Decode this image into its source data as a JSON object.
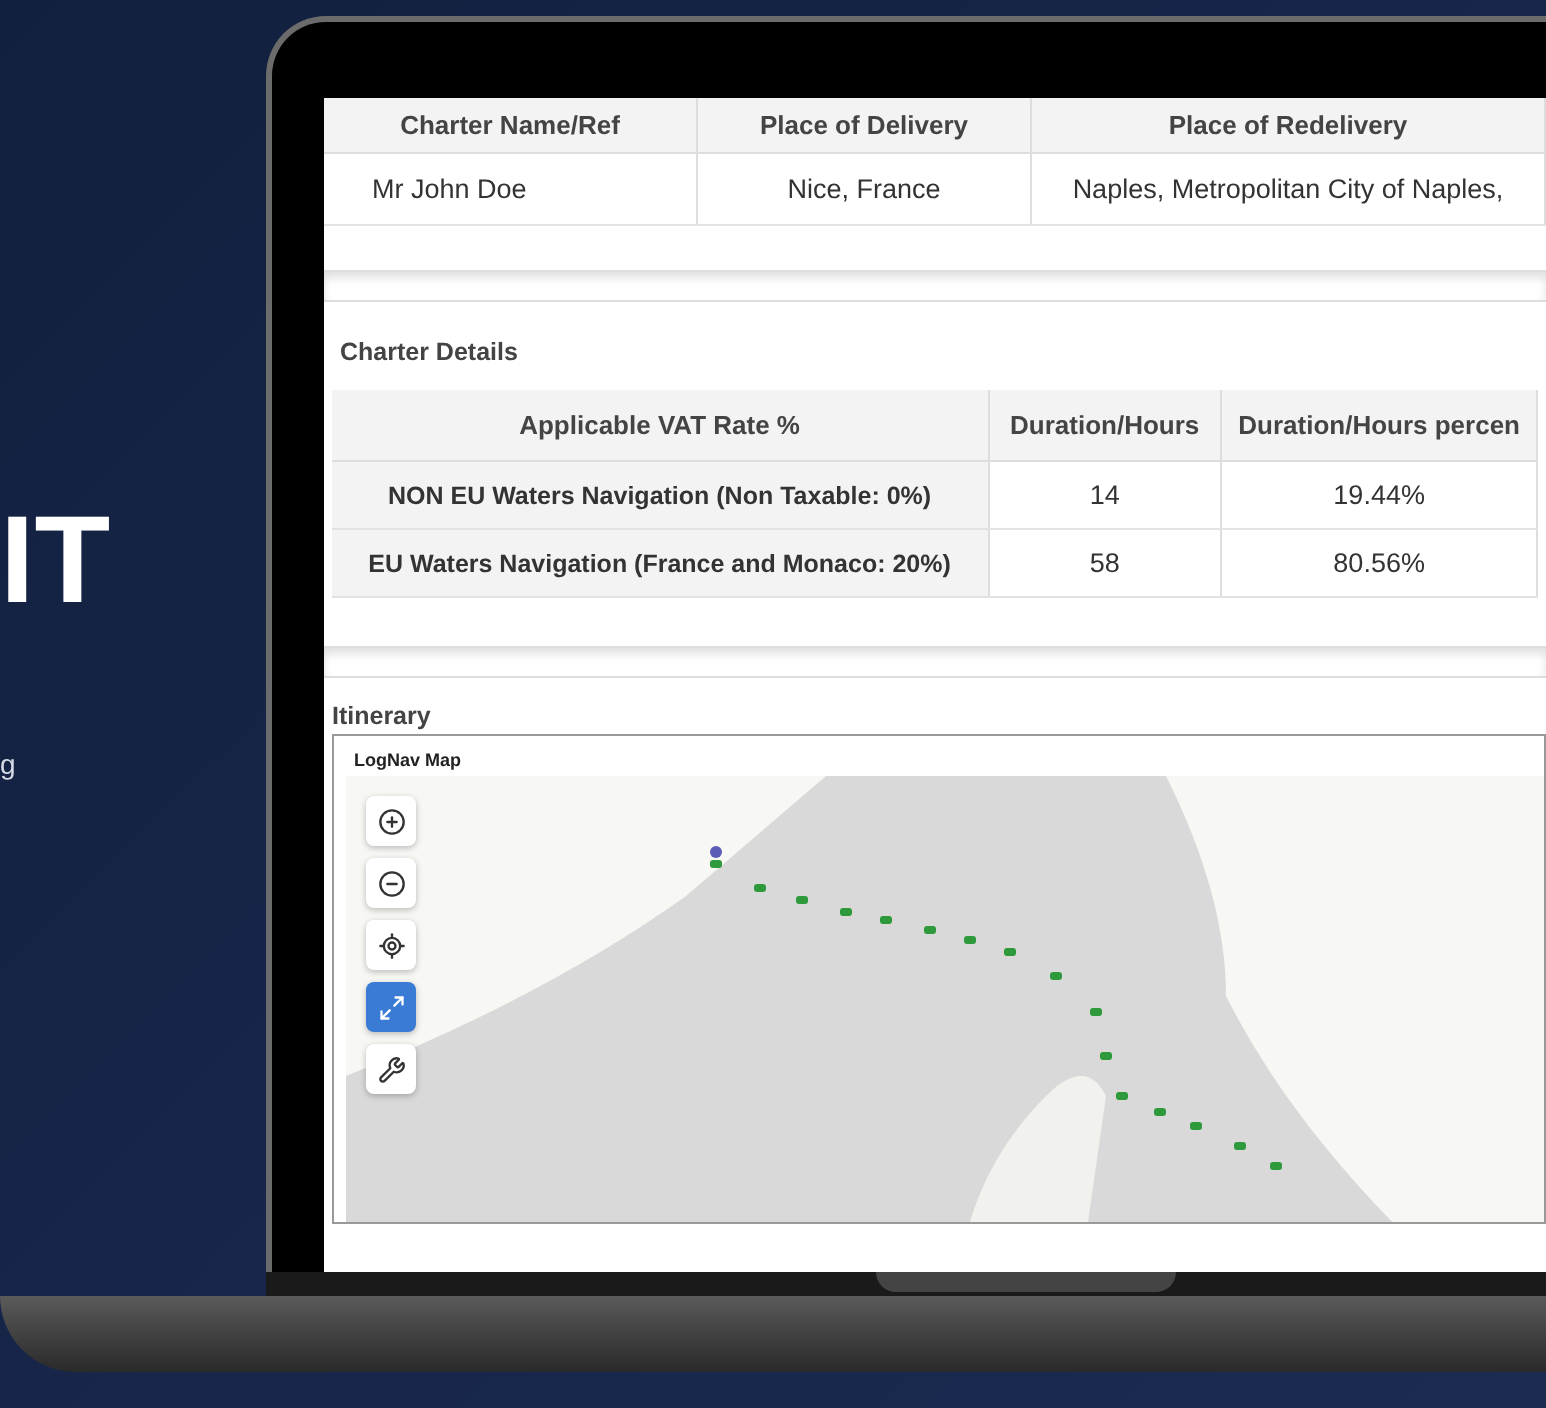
{
  "hero": {
    "heading": "IT",
    "subtitle": "g"
  },
  "booking_table": {
    "columns": [
      "Charter Name/Ref",
      "Place of Delivery",
      "Place of Redelivery"
    ],
    "rows": [
      [
        "Mr John Doe",
        "Nice, France",
        "Naples, Metropolitan City of Naples,"
      ]
    ]
  },
  "charter_details": {
    "title": "Charter Details",
    "columns": [
      "Applicable VAT Rate %",
      "Duration/Hours",
      "Duration/Hours percen"
    ],
    "rows": [
      [
        "NON EU Waters Navigation (Non Taxable: 0%)",
        "14",
        "19.44%"
      ],
      [
        "EU Waters Navigation (France and Monaco: 20%)",
        "58",
        "80.56%"
      ]
    ]
  },
  "itinerary": {
    "title": "Itinerary",
    "map": {
      "title": "LogNav Map",
      "controls": [
        {
          "kind": "zoom-in",
          "selected": false
        },
        {
          "kind": "zoom-out",
          "selected": false
        },
        {
          "kind": "locate",
          "selected": false
        },
        {
          "kind": "fullscreen",
          "selected": true
        },
        {
          "kind": "tools",
          "selected": false
        }
      ]
    }
  }
}
